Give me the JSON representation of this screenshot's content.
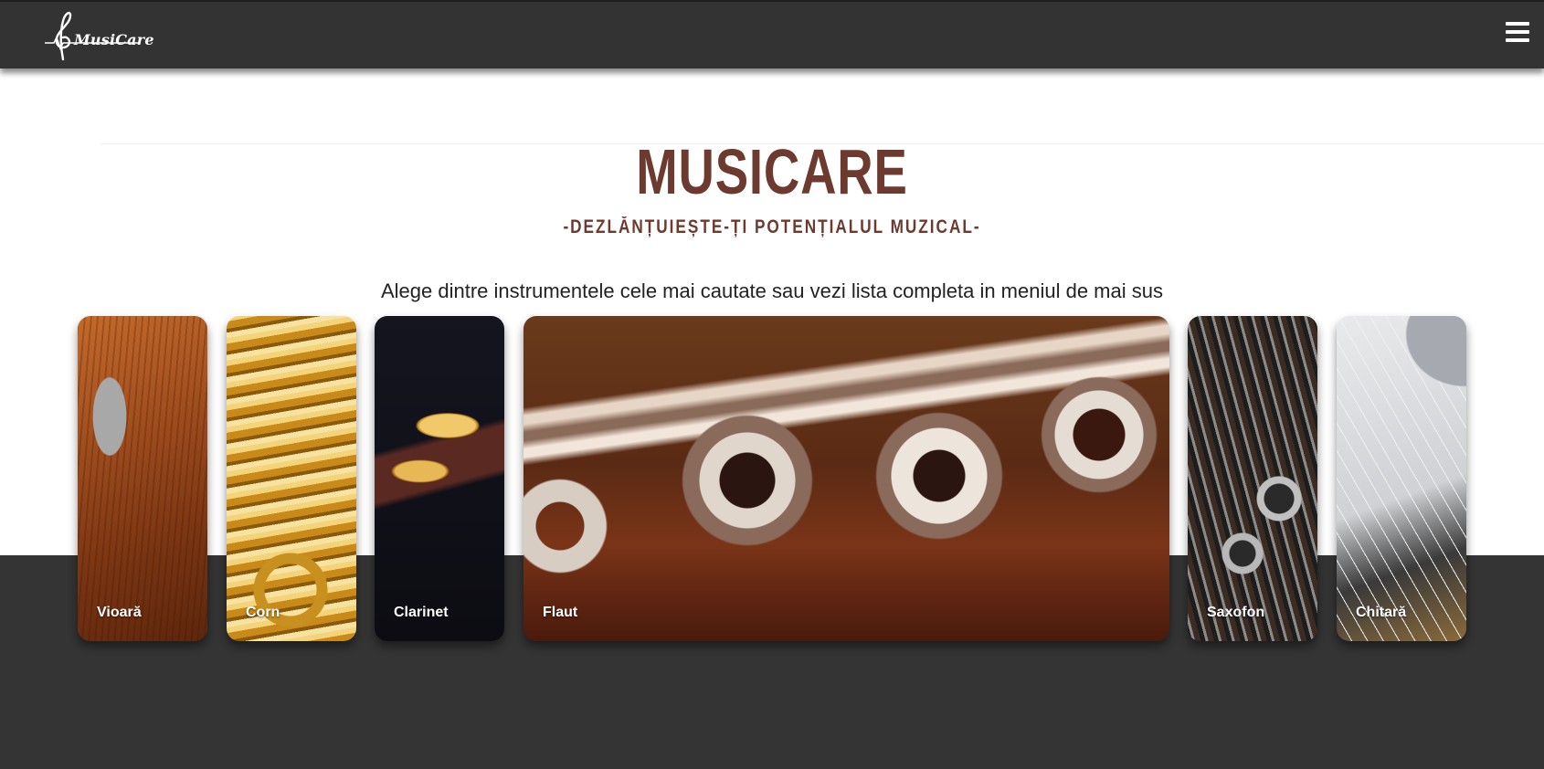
{
  "header": {
    "logo_text": "MusiCare",
    "menu_icon": "hamburger-menu-icon"
  },
  "hero": {
    "title": "MUSICARE",
    "subtitle": "-DEZLĂNȚUIEȘTE-ȚI POTENȚIALUL MUZICAL-",
    "intro": "Alege dintre instrumentele cele mai cautate sau vezi lista completa in meniul de mai sus"
  },
  "instruments": [
    {
      "label": "Vioară"
    },
    {
      "label": "Corn"
    },
    {
      "label": "Clarinet"
    },
    {
      "label": "Flaut"
    },
    {
      "label": "Saxofon"
    },
    {
      "label": "Chitară"
    }
  ],
  "colors": {
    "navbar": "#333333",
    "accent": "#6d3a30",
    "footer": "#343434"
  }
}
